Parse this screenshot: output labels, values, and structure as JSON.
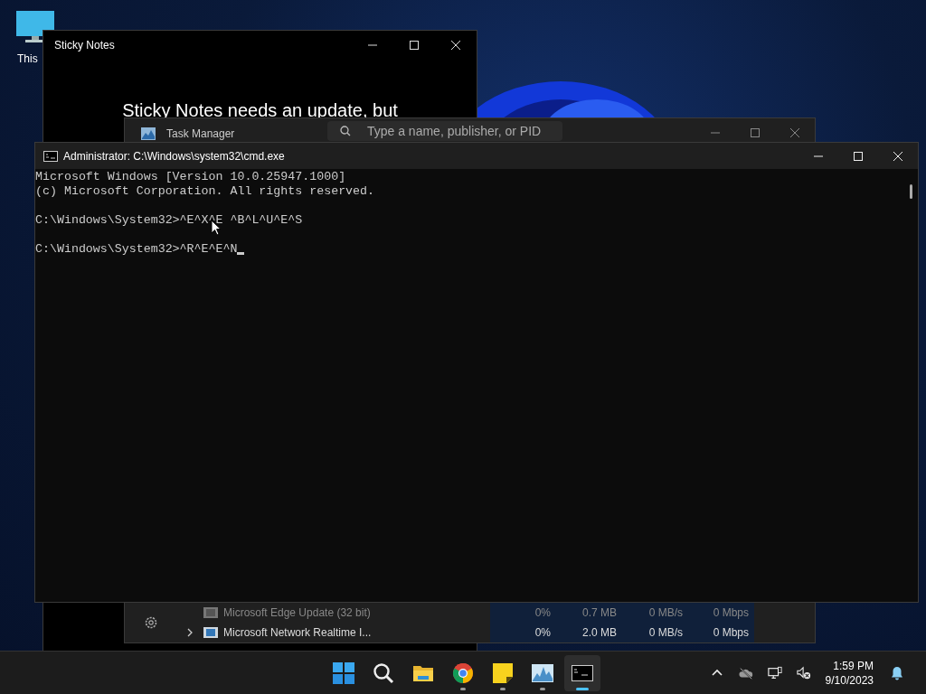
{
  "desktop": {
    "icons": [
      {
        "label": "This"
      }
    ]
  },
  "sticky_notes": {
    "title": "Sticky Notes",
    "message_lines": [
      "Sticky Notes needs an update, but"
    ]
  },
  "task_manager": {
    "title": "Task Manager",
    "search": {
      "placeholder": "Type a name, publisher, or PID"
    },
    "rows": [
      {
        "name": "Microsoft Edge Update (32 bit)",
        "cpu": "0%",
        "memory": "0.7 MB",
        "disk": "0 MB/s",
        "network": "0 Mbps",
        "expandable": false,
        "dimmed": true
      },
      {
        "name": "Microsoft Network Realtime I...",
        "cpu": "0%",
        "memory": "2.0 MB",
        "disk": "0 MB/s",
        "network": "0 Mbps",
        "expandable": true,
        "dimmed": false
      }
    ]
  },
  "console": {
    "title": "Administrator: C:\\Windows\\system32\\cmd.exe",
    "cursor": true,
    "blocks": [
      [
        "Microsoft Windows [Version 10.0.25947.1000]",
        "(c) Microsoft Corporation. All rights reserved."
      ],
      [
        "C:\\Windows\\System32>^E^X^E ^B^L^U^E^S"
      ],
      [
        "C:\\Windows\\System32>^R^E^E^N"
      ]
    ]
  },
  "taskbar": {
    "apps": [
      {
        "kind": "start",
        "running": false,
        "selected": false
      },
      {
        "kind": "search",
        "running": false,
        "selected": false
      },
      {
        "kind": "explorer",
        "running": false,
        "selected": false
      },
      {
        "kind": "browser",
        "running": true,
        "selected": false
      },
      {
        "kind": "notes",
        "running": true,
        "selected": false
      },
      {
        "kind": "monitor",
        "running": true,
        "selected": false
      },
      {
        "kind": "terminal",
        "running": true,
        "selected": true
      }
    ],
    "clock": {
      "time": "1:59 PM",
      "date": "9/10/2023"
    }
  }
}
